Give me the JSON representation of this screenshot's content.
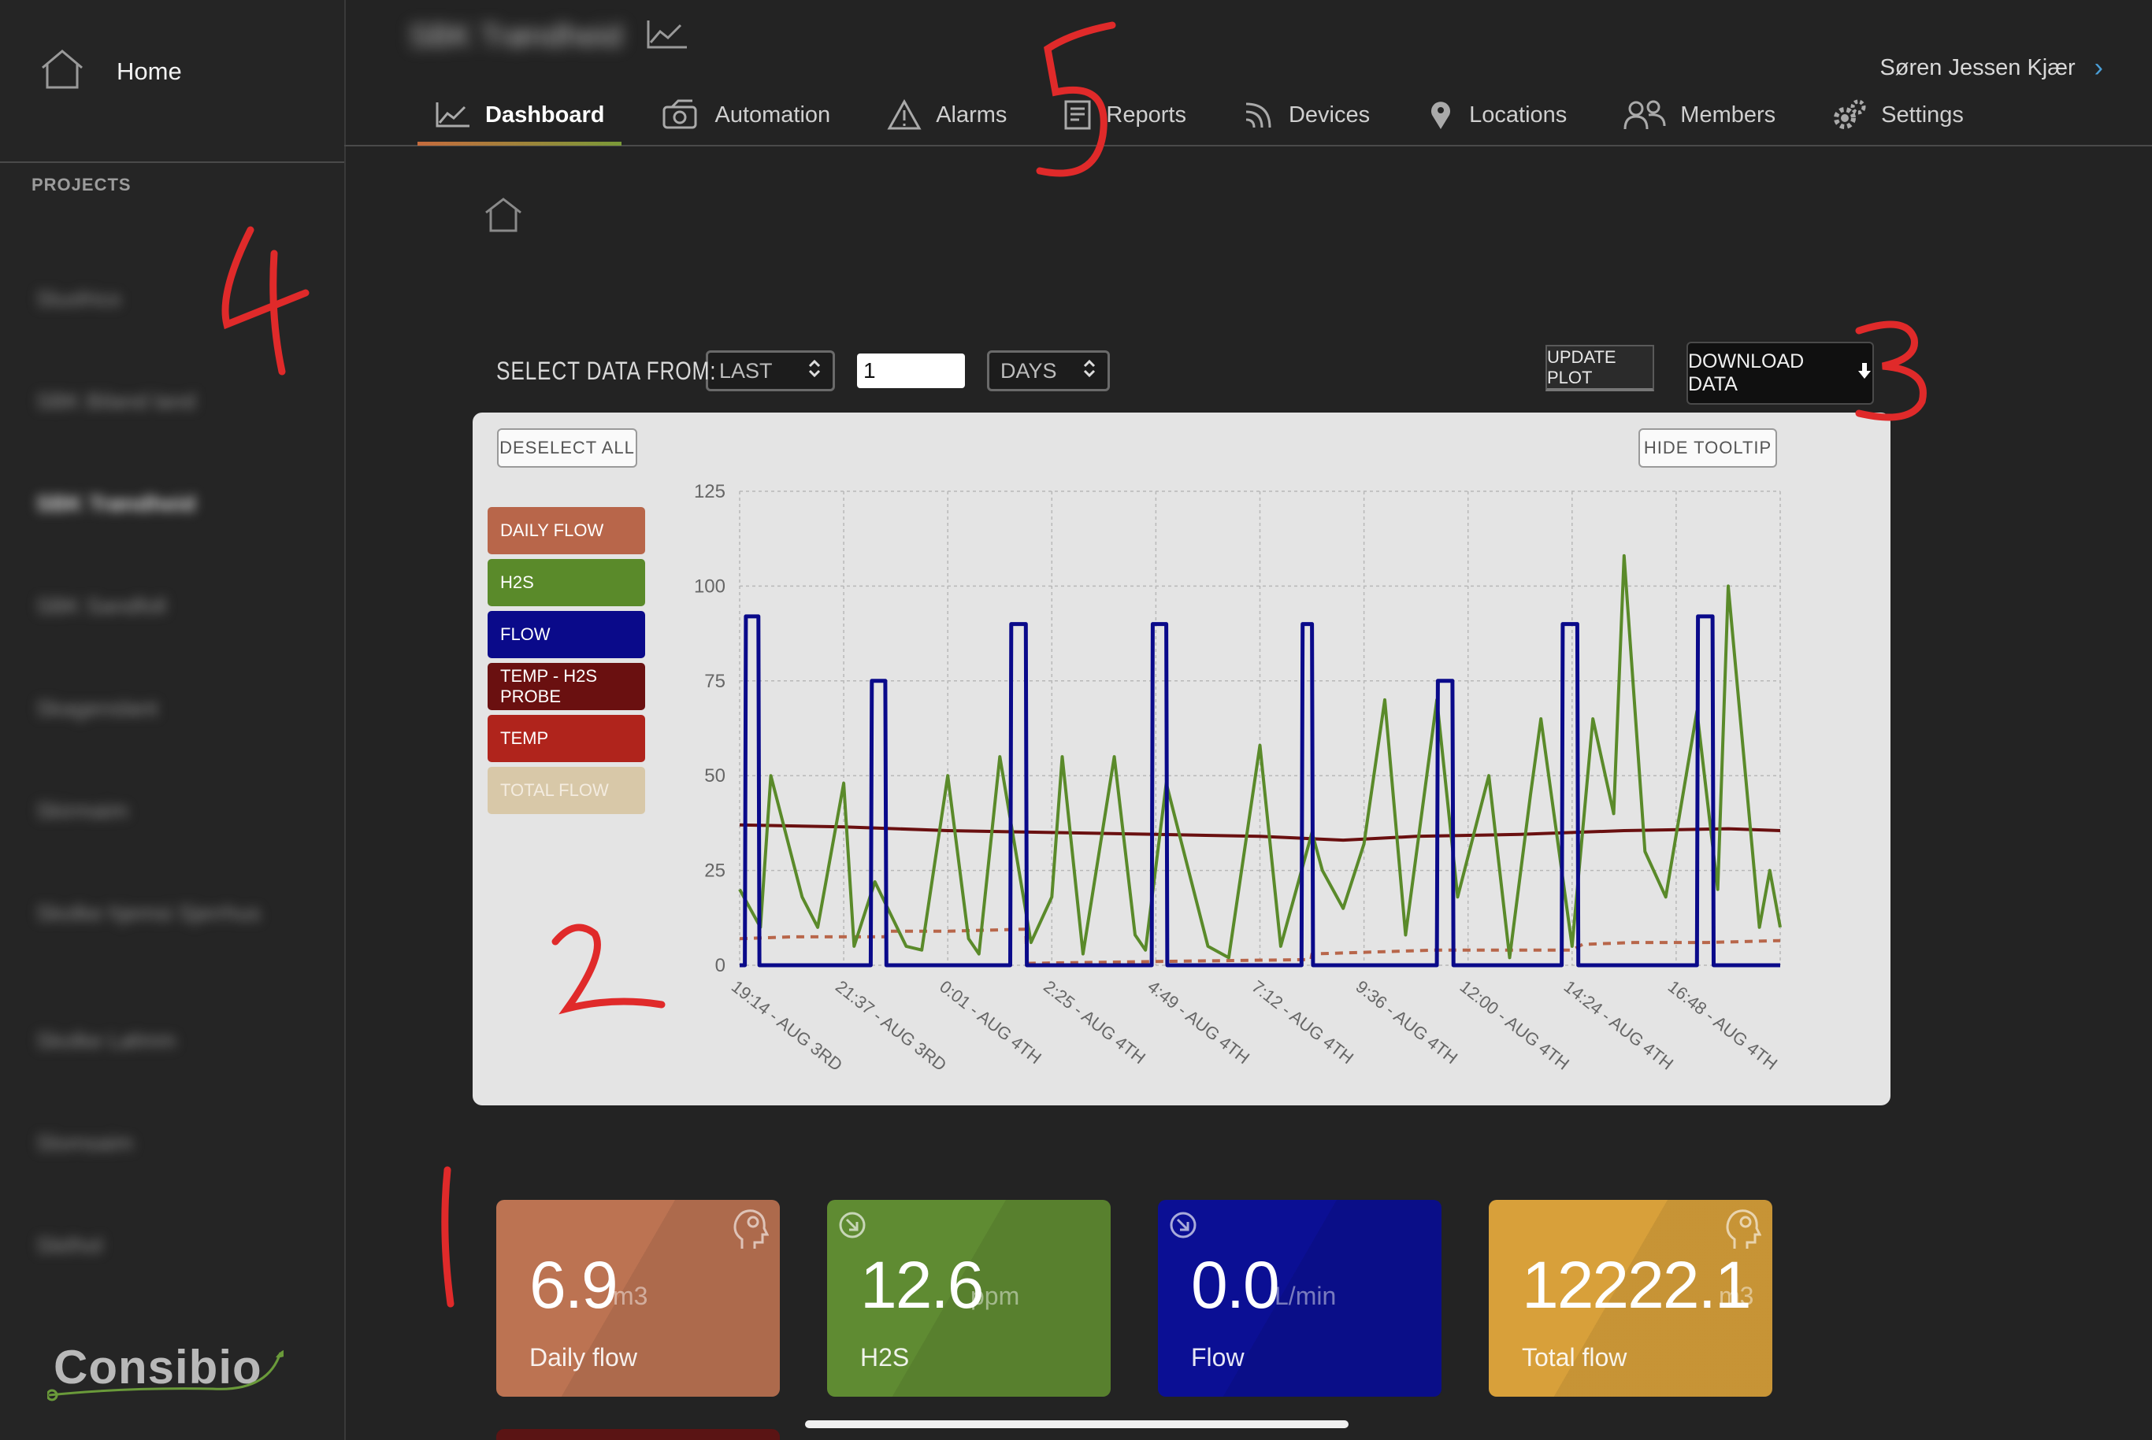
{
  "sidebar": {
    "home_label": "Home",
    "projects_label": "PROJECTS",
    "projects": [
      "Slusfrico",
      "SBK Biland land",
      "SBK Trøndheid",
      "SBK Sandfoll",
      "Skagenslant",
      "Skirmaim",
      "Skolke hjemsi Sjerrhus",
      "Skolke Lølmm",
      "Slomsaim",
      "Slelhol"
    ],
    "logo_text": "Consibio"
  },
  "header": {
    "project_title_blurred": "SBK Trøndheid",
    "user_name": "Søren Jessen Kjær",
    "tabs": [
      {
        "label": "Dashboard",
        "icon": "chart-line-icon",
        "active": true
      },
      {
        "label": "Automation",
        "icon": "automation-icon",
        "active": false
      },
      {
        "label": "Alarms",
        "icon": "warning-triangle-icon",
        "active": false
      },
      {
        "label": "Reports",
        "icon": "report-icon",
        "active": false
      },
      {
        "label": "Devices",
        "icon": "signal-icon",
        "active": false
      },
      {
        "label": "Locations",
        "icon": "map-pin-icon",
        "active": false
      },
      {
        "label": "Members",
        "icon": "members-icon",
        "active": false
      },
      {
        "label": "Settings",
        "icon": "gears-icon",
        "active": false
      }
    ]
  },
  "controls": {
    "select_data_from": "SELECT DATA FROM:",
    "period_select": "LAST",
    "amount_value": "1",
    "unit_select": "DAYS",
    "update_plot": "UPDATE PLOT",
    "download_data": "DOWNLOAD DATA"
  },
  "chart_card": {
    "deselect_all": "DESELECT ALL",
    "hide_tooltip": "HIDE TOOLTIP"
  },
  "chart_data": {
    "type": "line",
    "ylim": [
      0,
      125
    ],
    "yticks": [
      "125",
      "100",
      "75",
      "50",
      "25",
      "0"
    ],
    "x_ticks": [
      "19:14 - AUG 3RD",
      "21:37 - AUG 3RD",
      "0:01 - AUG 4TH",
      "2:25 - AUG 4TH",
      "4:49 - AUG 4TH",
      "7:12 - AUG 4TH",
      "9:36 - AUG 4TH",
      "12:00 - AUG 4TH",
      "14:24 - AUG 4TH",
      "16:48 - AUG 4TH"
    ],
    "series": [
      {
        "name": "DAILY FLOW",
        "color": "#b8664a",
        "style": "dashed",
        "x": [
          0.0,
          0.5,
          1.4,
          1.41,
          2.0,
          2.75,
          2.76,
          4.0,
          5.49,
          5.5,
          6.7,
          6.71,
          7.5,
          8.0,
          8.1,
          8.6,
          9.3,
          10.0
        ],
        "values": [
          7.0,
          7.5,
          7.5,
          9.0,
          9.0,
          9.5,
          0.5,
          1.0,
          1.5,
          3.0,
          4.0,
          4.0,
          4.0,
          4.0,
          5.5,
          6.0,
          6.0,
          6.5
        ]
      },
      {
        "name": "H2S",
        "color": "#5a8a2a",
        "style": "solid",
        "x": [
          0.0,
          0.2,
          0.3,
          0.6,
          0.75,
          1.0,
          1.1,
          1.3,
          1.6,
          1.75,
          2.0,
          2.2,
          2.3,
          2.5,
          2.8,
          3.0,
          3.1,
          3.3,
          3.6,
          3.8,
          3.9,
          4.1,
          4.5,
          4.7,
          5.0,
          5.2,
          5.5,
          5.6,
          5.8,
          6.0,
          6.2,
          6.4,
          6.7,
          6.9,
          7.2,
          7.4,
          7.6,
          7.7,
          8.0,
          8.2,
          8.4,
          8.5,
          8.7,
          8.9,
          9.2,
          9.4,
          9.5,
          9.8,
          9.9,
          10.0
        ],
        "values": [
          20,
          10,
          50,
          18,
          10,
          48,
          5,
          22,
          5,
          4,
          50,
          7,
          3,
          55,
          6,
          18,
          55,
          3,
          55,
          8,
          4,
          48,
          5,
          2,
          58,
          5,
          35,
          25,
          15,
          32,
          70,
          8,
          70,
          18,
          50,
          2,
          45,
          65,
          5,
          65,
          40,
          108,
          30,
          18,
          67,
          20,
          100,
          10,
          25,
          10
        ]
      },
      {
        "name": "FLOW",
        "color": "#0a0a8a",
        "style": "solid",
        "x": [
          0.0,
          0.05,
          0.06,
          0.18,
          0.19,
          1.26,
          1.27,
          1.4,
          1.41,
          2.6,
          2.61,
          2.75,
          2.76,
          3.96,
          3.97,
          4.1,
          4.11,
          5.4,
          5.41,
          5.5,
          5.51,
          6.7,
          6.71,
          6.85,
          6.86,
          7.9,
          7.91,
          8.05,
          8.06,
          9.2,
          9.21,
          9.35,
          9.36,
          10.0
        ],
        "values": [
          0,
          0,
          92,
          92,
          0,
          0,
          75,
          75,
          0,
          0,
          90,
          90,
          0,
          0,
          90,
          90,
          0,
          0,
          90,
          90,
          0,
          0,
          75,
          75,
          0,
          0,
          90,
          90,
          0,
          0,
          92,
          92,
          0,
          0
        ]
      },
      {
        "name": "TEMP - H2S PROBE",
        "color": "#6a1010",
        "style": "solid",
        "x": [
          0.0,
          1.0,
          2.0,
          3.0,
          4.0,
          5.0,
          5.8,
          6.5,
          7.5,
          8.5,
          9.5,
          10.0
        ],
        "values": [
          37,
          36.5,
          35.5,
          35,
          34.5,
          34,
          33,
          34,
          34.5,
          35.5,
          36,
          35.5
        ]
      },
      {
        "name": "TEMP",
        "color": "#b0241c",
        "style": "solid",
        "x": [],
        "values": []
      },
      {
        "name": "TOTAL FLOW",
        "color": "#d8c8a8",
        "style": "solid",
        "x": [],
        "values": []
      }
    ]
  },
  "tiles": [
    {
      "value": "6.9",
      "unit": "m3",
      "label": "Daily flow",
      "color": "#bc7352",
      "icon": "ai-head-icon"
    },
    {
      "value": "12.6",
      "unit": "ppm",
      "label": "H2S",
      "color": "#5f8b32",
      "icon": "arrow-down-circle-icon"
    },
    {
      "value": "0.0",
      "unit": "L/min",
      "label": "Flow",
      "color": "#0b0f94",
      "icon": "arrow-down-circle-icon"
    },
    {
      "value": "12222.1",
      "unit": "m3",
      "label": "Total flow",
      "color": "#d8a03a",
      "icon": "ai-head-icon"
    }
  ],
  "annotations": [
    "1",
    "2",
    "3",
    "4",
    "5"
  ],
  "annotation_color": "#e02a2a"
}
